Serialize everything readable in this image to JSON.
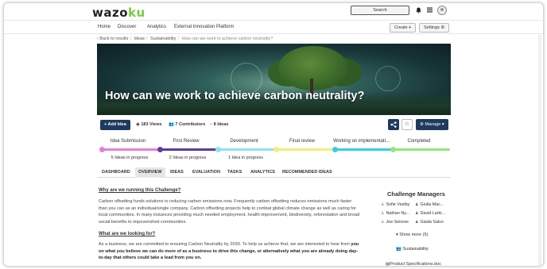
{
  "header": {
    "logo_main": "wazo",
    "logo_accent": "ku",
    "search_label": "Search",
    "bell_icon": "bell-icon",
    "menu_icon": "list-icon"
  },
  "nav": {
    "items": [
      "Home",
      "Discover",
      "Analytics",
      "External Innovation Platform"
    ],
    "create_label": "Create",
    "settings_label": "Settings"
  },
  "breadcrumb": {
    "back": "Back to results",
    "items": [
      "Ideas",
      "Sustainability"
    ],
    "current": "How can we work to achieve carbon neutrality?"
  },
  "banner": {
    "title": "How can we work to achieve carbon neutrality?"
  },
  "actions": {
    "add_idea": "Add Idea",
    "views": "183 Views",
    "contributors": "7 Contributors",
    "ideas": "8 Ideas",
    "manage": "Manage"
  },
  "stages": [
    {
      "name": "Idea Submission",
      "count": "5 Ideas in progress",
      "color": "#e57fd6"
    },
    {
      "name": "First Review",
      "count": "2 Ideas in progress",
      "color": "#5b3d9e"
    },
    {
      "name": "Development",
      "count": "1 Idea in progress",
      "color": "#8fe3ef"
    },
    {
      "name": "Final review",
      "count": "",
      "color": "#f2ee7a"
    },
    {
      "name": "Working on implementati...",
      "count": "",
      "color": "#33cfe6"
    },
    {
      "name": "Completed",
      "count": "",
      "color": "#8fe878"
    }
  ],
  "tabs": [
    "DASHBOARD",
    "OVERVIEW",
    "IDEAS",
    "EVALUATION",
    "TASKS",
    "ANALYTICS",
    "RECOMMENDED IDEAS"
  ],
  "content": {
    "q1": "Why are we running this Challenge?",
    "p1": "Carbon offsetting funds solutions to reducing carbon emissions now. Frequently carbon offsetting reduces emissions much faster than you can as an individual/single company. Carbon offsetting projects help to combat global climate change as well as caring for local communities. In many instances providing much needed employment, health improvement, biodiversity, reforestation and broad social benefits to impoverished communities.",
    "q2": "What are we looking for?",
    "p2_start": "As a business, we are committed to ensuring Carbon Neutrality by 2030. To help us achieve that, we are interested to hear from ",
    "p2_bold": "you on what you believe we can do more of as a business to drive this change, or alternatively what you are already doing day-to-day that others could take a lead from you on."
  },
  "sidebar": {
    "title": "Challenge Managers",
    "managers": [
      "Sofie Vestby",
      "Giulia Mac...",
      "Nathan Ny...",
      "David Larki...",
      "Joe Seiorse",
      "Giada Salvo"
    ],
    "show_more": "Show more (5)",
    "tag": "Sustainability",
    "attachment": "Product Specifications.doc"
  }
}
